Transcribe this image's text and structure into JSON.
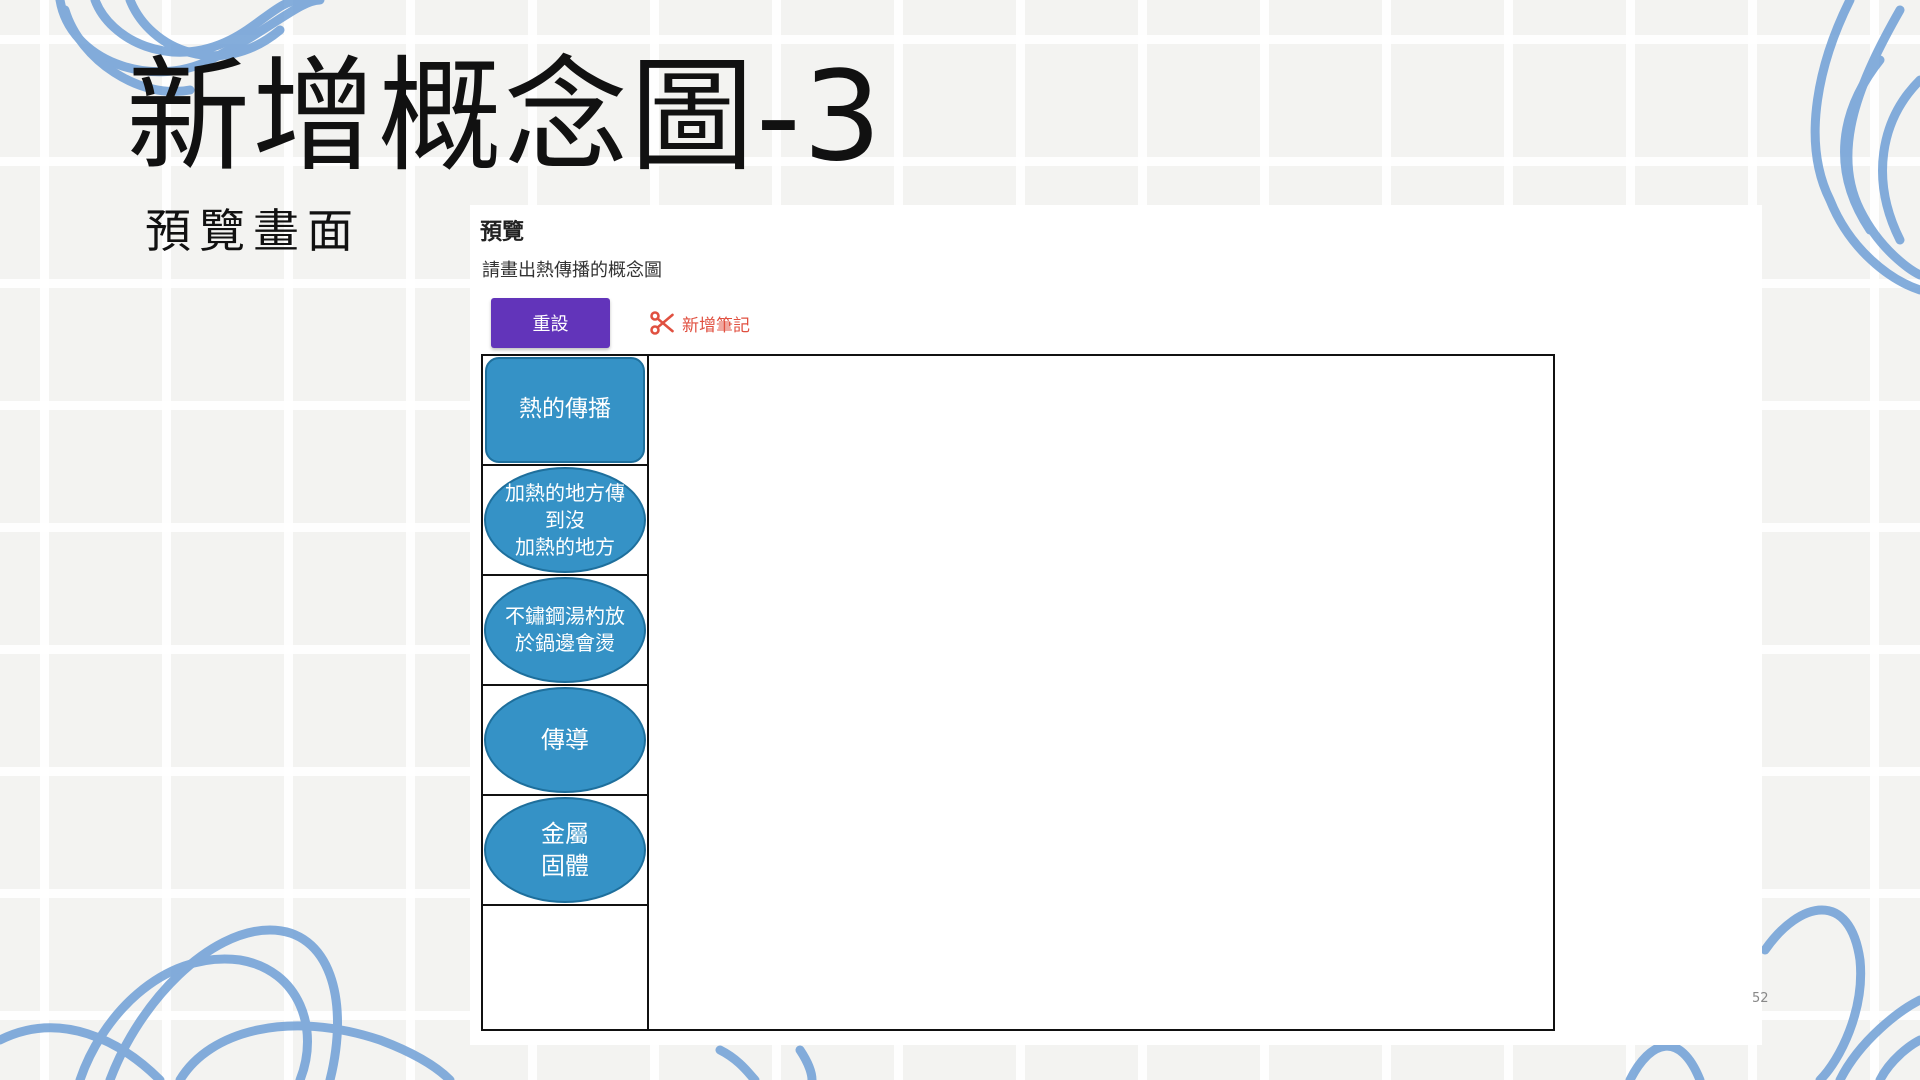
{
  "slide": {
    "title": "新增概念圖-3",
    "subtitle": "預覽畫面",
    "page_number": "52"
  },
  "preview": {
    "heading": "預覽",
    "question": "請畫出熱傳播的概念圖",
    "reset_label": "重設",
    "add_note_label": "新增筆記",
    "accent_color": "#6234ba",
    "node_color": "#3592c6"
  },
  "concept_nodes": [
    {
      "text": "熱的傳播",
      "shape": "rounded-rectangle"
    },
    {
      "text": "加熱的地方傳到沒\n加熱的地方",
      "shape": "ellipse"
    },
    {
      "text": "不鏽鋼湯杓放\n於鍋邊會燙",
      "shape": "ellipse"
    },
    {
      "text": "傳導",
      "shape": "ellipse"
    },
    {
      "text": "金屬\n固體",
      "shape": "ellipse"
    }
  ]
}
